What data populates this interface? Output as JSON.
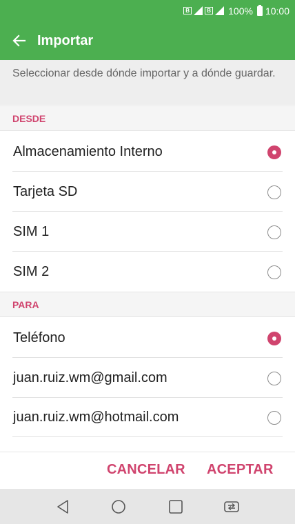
{
  "status_bar": {
    "net1": "B",
    "net2": "B",
    "battery": "100%",
    "time": "10:00"
  },
  "app_bar": {
    "back_icon": "arrow-left-icon",
    "title": "Importar"
  },
  "description": "Seleccionar desde dónde importar y a dónde guardar.",
  "sections": {
    "desde": {
      "header": "DESDE",
      "options": [
        {
          "label": "Almacenamiento Interno",
          "selected": true
        },
        {
          "label": "Tarjeta SD",
          "selected": false
        },
        {
          "label": "SIM 1",
          "selected": false
        },
        {
          "label": "SIM 2",
          "selected": false
        }
      ]
    },
    "para": {
      "header": "PARA",
      "options": [
        {
          "label": "Teléfono",
          "selected": true
        },
        {
          "label": "juan.ruiz.wm@gmail.com",
          "selected": false
        },
        {
          "label": "juan.ruiz.wm@hotmail.com",
          "selected": false
        }
      ]
    }
  },
  "buttons": {
    "cancel": "CANCELAR",
    "accept": "ACEPTAR"
  },
  "nav_bar": {
    "icons": [
      "back-triangle-icon",
      "home-circle-icon",
      "recents-square-icon",
      "dual-window-icon"
    ]
  },
  "colors": {
    "primary": "#4caf50",
    "accent": "#d0446e"
  }
}
